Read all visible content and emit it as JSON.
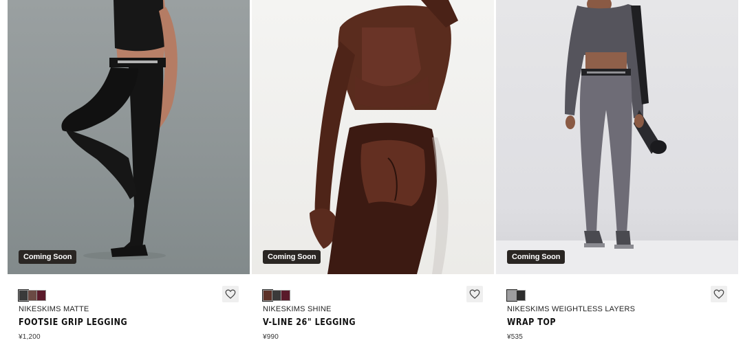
{
  "products": [
    {
      "badge": "Coming Soon",
      "swatch_colors": [
        "#3a3a3a",
        "#6b4a44",
        "#5a1a2a"
      ],
      "collection": "NIKESKIMS MATTE",
      "name": "FOOTSIE GRIP LEGGING",
      "price": "¥1,200",
      "favorite_icon": "heart-outline-icon"
    },
    {
      "badge": "Coming Soon",
      "swatch_colors": [
        "#5c3128",
        "#3b3a3a",
        "#5a1a2a"
      ],
      "collection": "NIKESKIMS SHINE",
      "name": "V-LINE 26\" LEGGING",
      "price": "¥990",
      "favorite_icon": "heart-outline-icon"
    },
    {
      "badge": "Coming Soon",
      "swatch_colors": [
        "#9e9ea0",
        "#2e2e2e"
      ],
      "collection": "NIKESKIMS WEIGHTLESS LAYERS",
      "name": "WRAP TOP",
      "price": "¥535",
      "favorite_icon": "heart-outline-icon"
    }
  ]
}
